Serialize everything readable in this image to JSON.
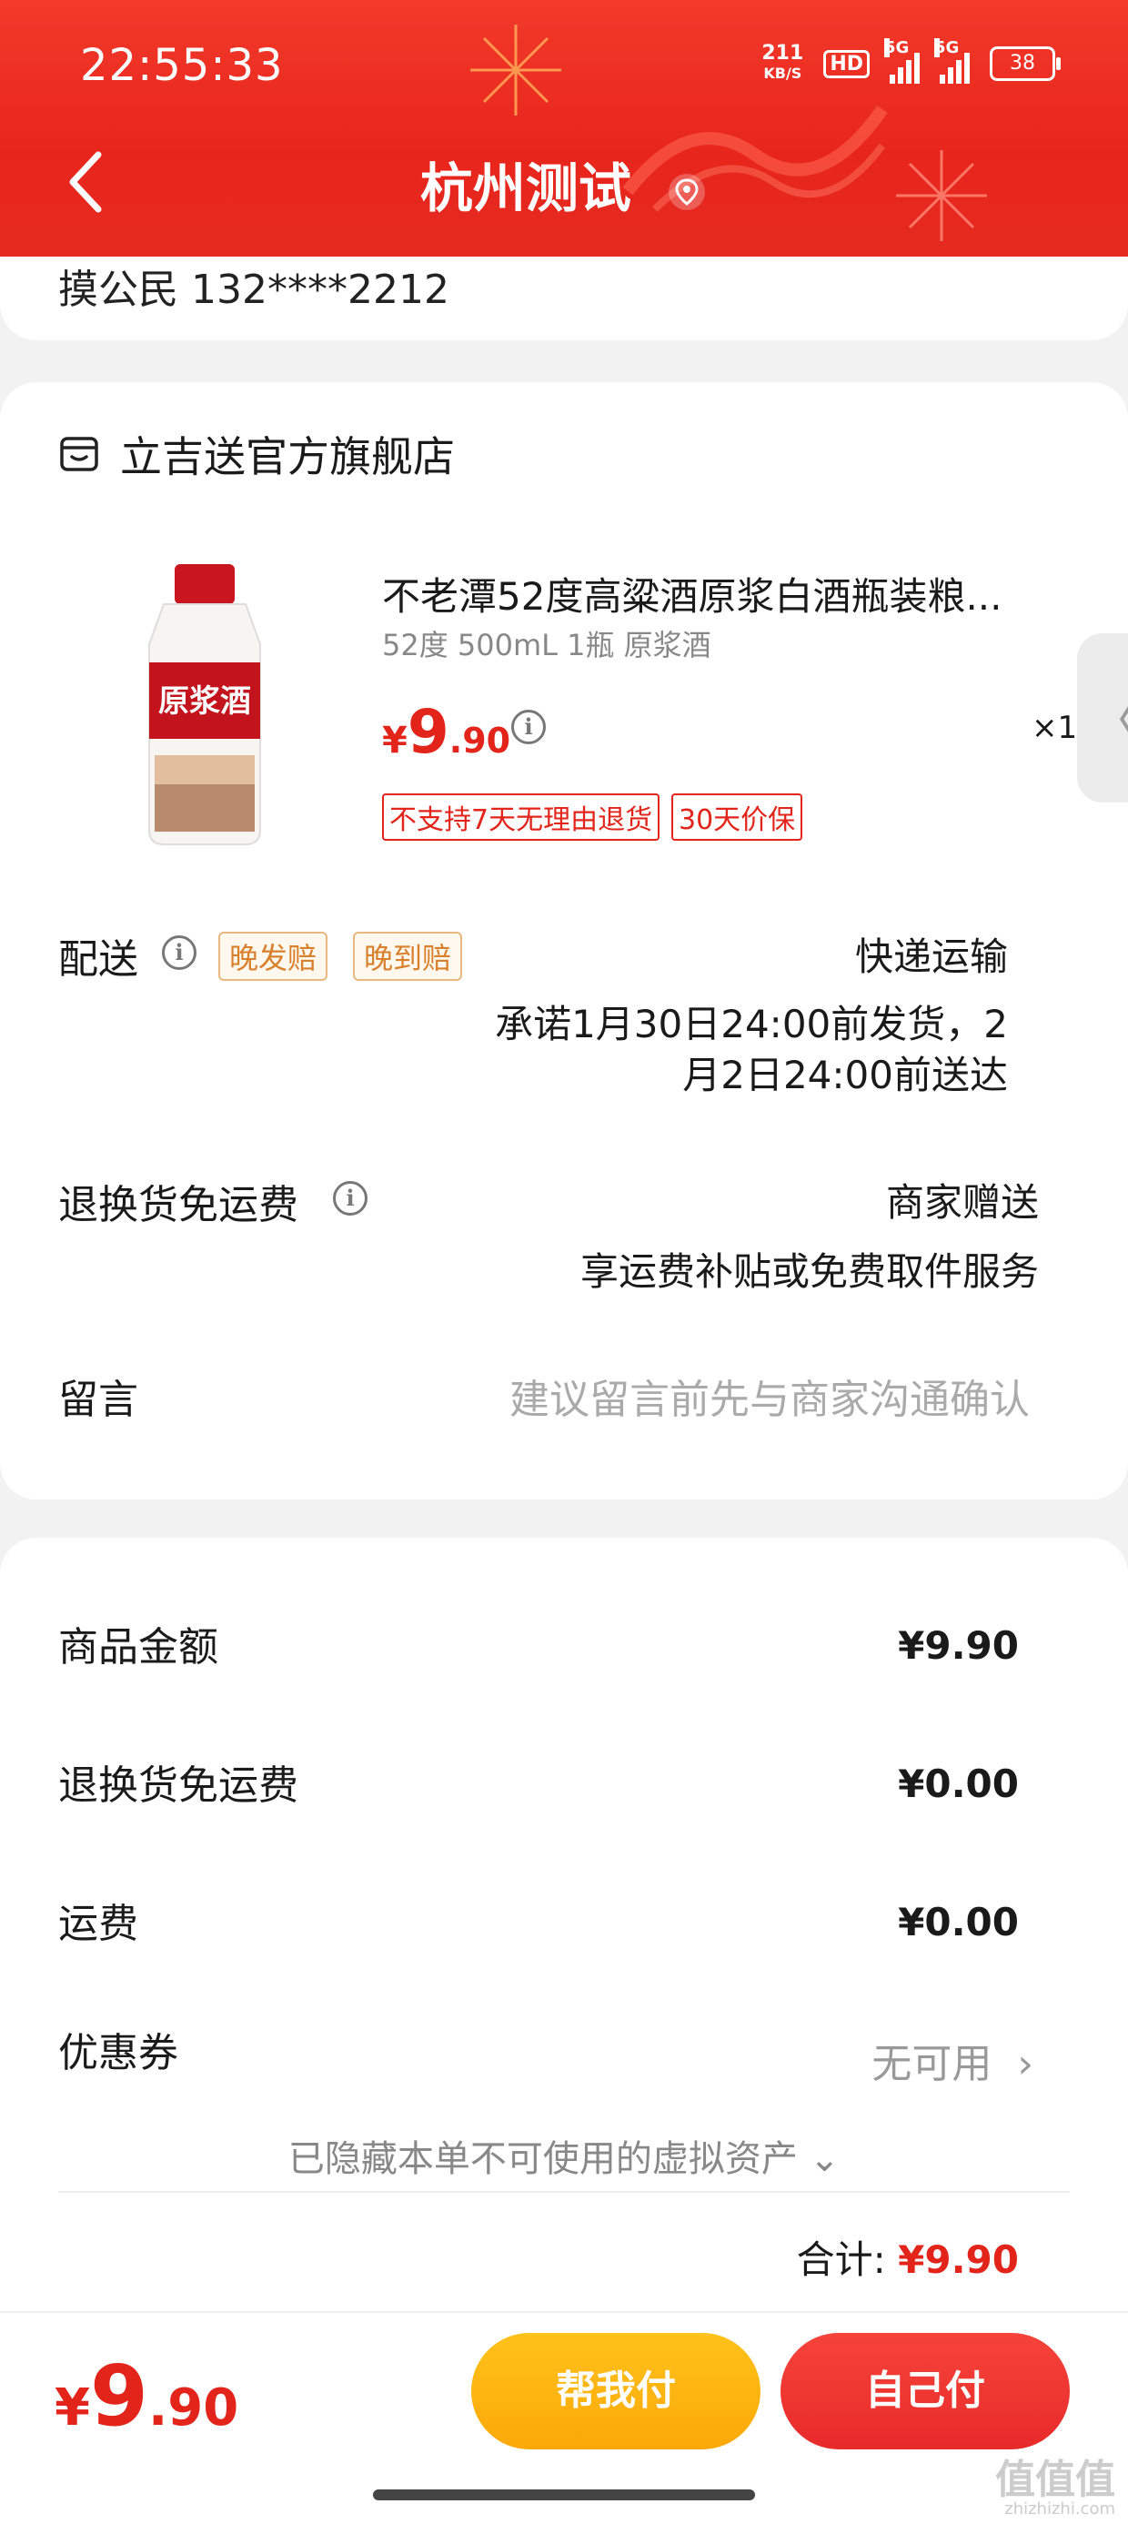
{
  "status_bar": {
    "time": "22:55:33",
    "net_speed_value": "211",
    "net_speed_unit": "KB/S",
    "hd_label": "HD",
    "signal1_label": "5G",
    "signal2_label": "5G",
    "battery": "38"
  },
  "header": {
    "title": "杭州测试"
  },
  "address": {
    "name_phone": "摸公民  132****2212"
  },
  "store": {
    "name": "立吉送官方旗舰店"
  },
  "product": {
    "title": "不老潭52度高粱酒原浆白酒瓶装粮...",
    "spec": "52度 500mL 1瓶 原浆酒",
    "price_symbol": "¥",
    "price_int": "9",
    "price_dec": ".90",
    "quantity": "×1",
    "tags": [
      "不支持7天无理由退货",
      "30天价保"
    ],
    "bottle_text": "原浆酒"
  },
  "delivery": {
    "label": "配送",
    "badges": [
      "晚发赔",
      "晚到赔"
    ],
    "method": "快递运输",
    "promise_line1": "承诺1月30日24:00前发货，2",
    "promise_line2": "月2日24:00前送达"
  },
  "return_shipping": {
    "label": "退换货免运费",
    "value": "商家赠送",
    "desc": "享运费补贴或免费取件服务"
  },
  "message": {
    "label": "留言",
    "placeholder": "建议留言前先与商家沟通确认"
  },
  "summary": {
    "rows": [
      {
        "label": "商品金额",
        "value": "¥9.90"
      },
      {
        "label": "退换货免运费",
        "value": "¥0.00"
      },
      {
        "label": "运费",
        "value": "¥0.00"
      }
    ],
    "coupon_label": "优惠券",
    "coupon_value": "无可用",
    "hidden_note": "已隐藏本单不可使用的虚拟资产",
    "total_label": "合计:",
    "total_value": "¥9.90"
  },
  "bottom": {
    "price_symbol": "¥",
    "price_int": "9",
    "price_dec": ".90",
    "help_pay": "帮我付",
    "self_pay": "自己付"
  },
  "watermark": {
    "text": "值值值",
    "url": "zhizhizhi.com"
  },
  "colors": {
    "brand_red": "#e3241b",
    "header_red": "#ea2b20",
    "help_yellow": "#fdb510"
  }
}
